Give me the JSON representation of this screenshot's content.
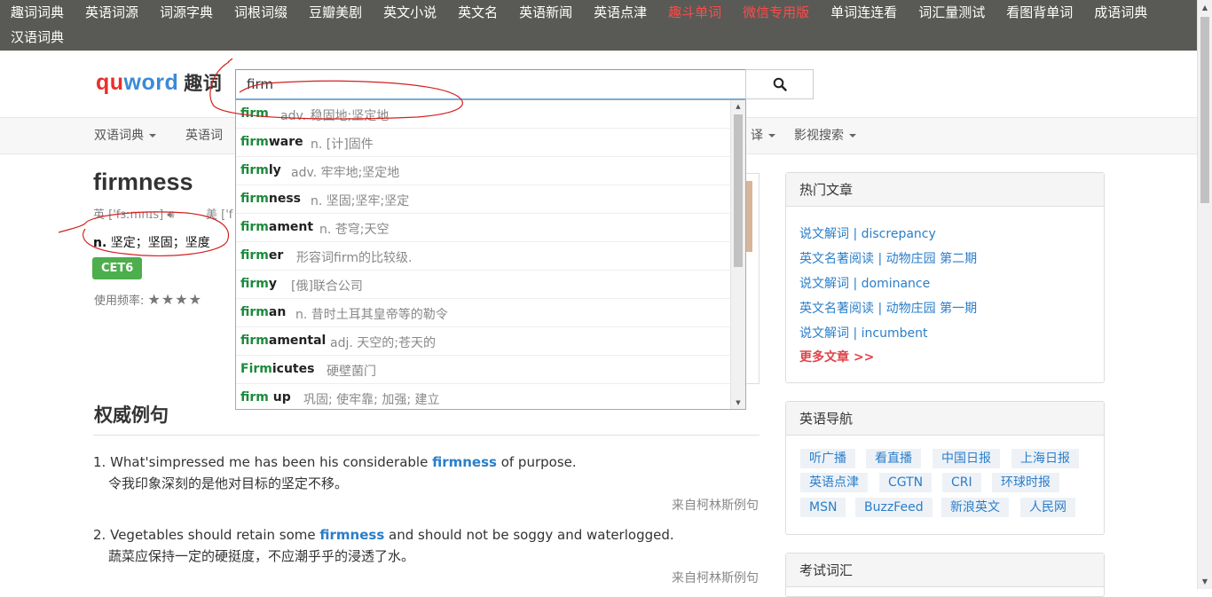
{
  "top_nav": {
    "row1": [
      "趣词词典",
      "英语词源",
      "词源字典",
      "词根词缀",
      "豆瓣美剧",
      "英文小说",
      "英文名",
      "英语新闻",
      "英语点津",
      "趣斗单词",
      "微信专用版",
      "单词连连看",
      "词汇量测试",
      "看图背单词",
      "成语词典"
    ],
    "row2": [
      "汉语词典"
    ],
    "highlight_color": "#ff4a4a"
  },
  "logo": {
    "part1": "qu",
    "part2": "word",
    "cn": "趣词"
  },
  "search": {
    "value": "firm"
  },
  "sub_nav": {
    "items": [
      "双语词典",
      "英语词",
      "译",
      "影视搜索"
    ]
  },
  "word": {
    "title": "firmness",
    "uk_label": "英",
    "uk_phonetic": "['fɜːmnɪs]",
    "us_label": "美",
    "us_phonetic": "['f",
    "pos": "n.",
    "definition": "坚定；坚固；坚度",
    "badge": "CET6",
    "freq_label": "使用频率:",
    "freq_stars": "★★★★"
  },
  "examples": {
    "heading": "权威例句",
    "items": [
      {
        "num": "1.",
        "before": "What'simpressed me has been his considerable ",
        "hl": "firmness",
        "after": " of purpose.",
        "cn": "令我印象深刻的是他对目标的坚定不移。",
        "source": "来自柯林斯例句"
      },
      {
        "num": "2.",
        "before": "Vegetables should retain some ",
        "hl": "firmness",
        "after": " and should not be soggy and waterlogged.",
        "cn": "蔬菜应保持一定的硬挺度，不应潮乎乎的浸透了水。",
        "source": "来自柯林斯例句"
      }
    ]
  },
  "hot_articles": {
    "title": "热门文章",
    "items": [
      "说文解词 | discrepancy",
      "英文名著阅读 | 动物庄园 第二期",
      "说文解词 | dominance",
      "英文名著阅读 | 动物庄园 第一期",
      "说文解词 | incumbent"
    ],
    "more": "更多文章 >>"
  },
  "english_nav": {
    "title": "英语导航",
    "tags": [
      "听广播",
      "看直播",
      "中国日报",
      "上海日报",
      "英语点津",
      "CGTN",
      "CRI",
      "环球时报",
      "MSN",
      "BuzzFeed",
      "新浪英文",
      "人民网"
    ]
  },
  "exam_vocab": {
    "title": "考试词汇"
  },
  "suggestions": [
    {
      "match": "firm",
      "rest": "",
      "def": "adv. 稳固地;坚定地"
    },
    {
      "match": "firm",
      "rest": "ware",
      "def": "n. [计]固件"
    },
    {
      "match": "firm",
      "rest": "ly",
      "def": "adv. 牢牢地;坚定地"
    },
    {
      "match": "firm",
      "rest": "ness",
      "def": "n. 坚固;坚牢;坚定"
    },
    {
      "match": "firm",
      "rest": "ament",
      "def": "n. 苍穹;天空"
    },
    {
      "match": "firm",
      "rest": "er",
      "def": "形容词firm的比较级."
    },
    {
      "match": "firm",
      "rest": "y",
      "def": "[俄]联合公司"
    },
    {
      "match": "firm",
      "rest": "an",
      "def": "n. 昔时土耳其皇帝等的勒令"
    },
    {
      "match": "firm",
      "rest": "amental",
      "def": "adj. 天空的;苍天的"
    },
    {
      "match": "Firm",
      "rest": "icutes",
      "def": "硬壁菌门"
    },
    {
      "match": "firm",
      "rest": " up",
      "def": "巩固; 使牢靠; 加强; 建立"
    }
  ],
  "icons": {
    "search": "search-icon",
    "speaker": "speaker-icon",
    "caret": "caret-down-icon"
  },
  "colors": {
    "accent_blue": "#2a7ec9",
    "cet_green": "#4cae4c",
    "nav_bg": "#595a55",
    "match_green": "#1c8a3c",
    "annotation_red": "#d42020"
  }
}
